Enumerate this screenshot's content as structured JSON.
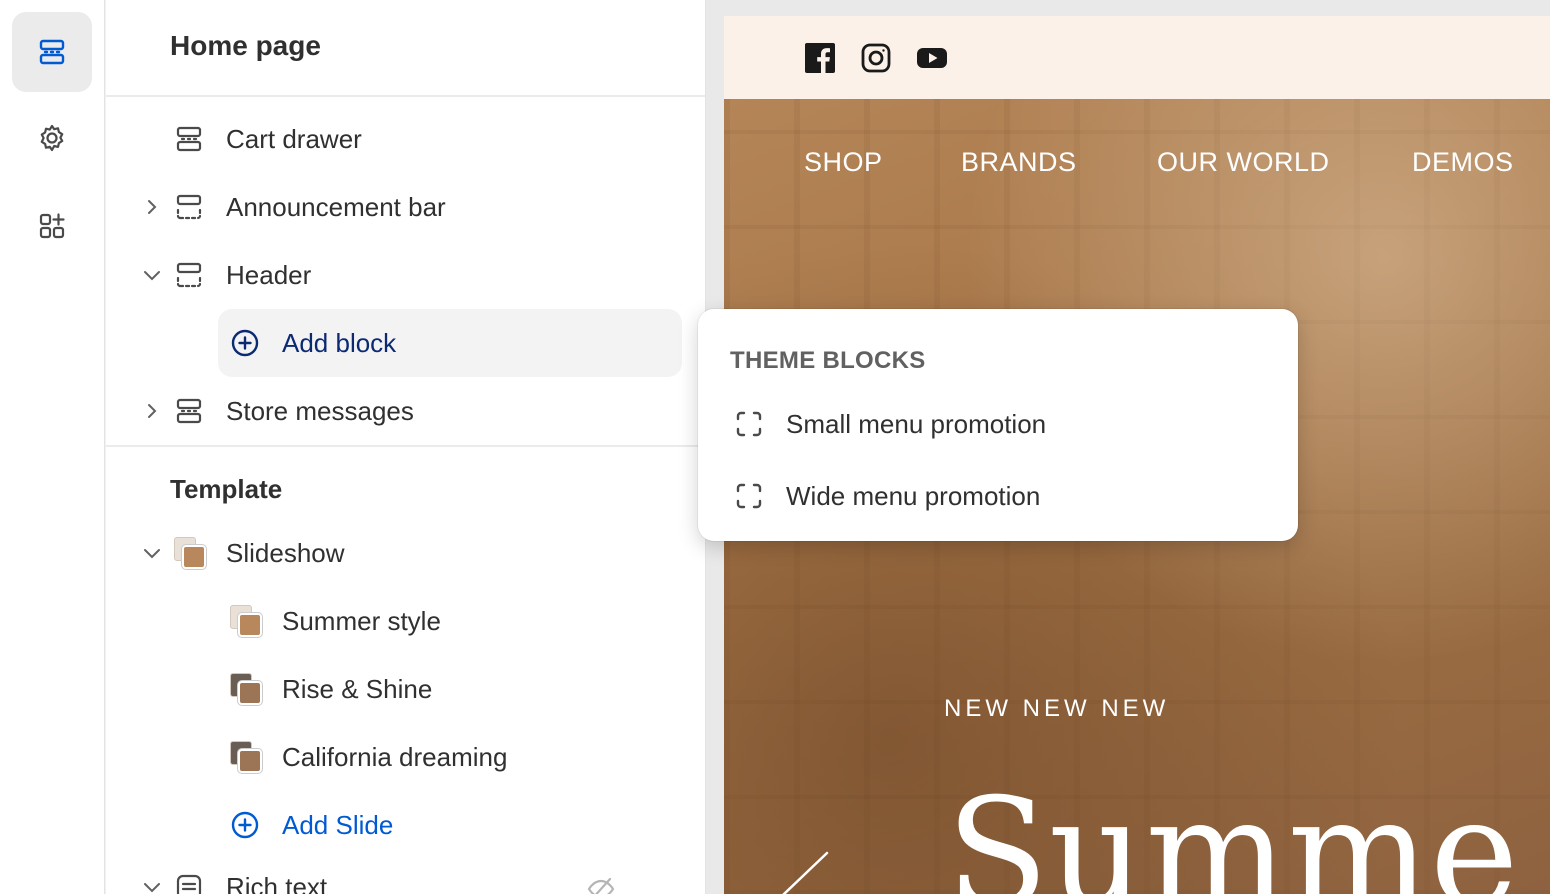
{
  "rail": {
    "items": [
      {
        "name": "sections",
        "icon": "sections-icon",
        "active": true
      },
      {
        "name": "settings",
        "icon": "gear-icon",
        "active": false
      },
      {
        "name": "apps",
        "icon": "apps-add-icon",
        "active": false
      }
    ]
  },
  "sidebar": {
    "title": "Home page",
    "header_group": {
      "cart_drawer": "Cart drawer",
      "announcement_bar": "Announcement bar",
      "header": "Header",
      "add_block": "Add block",
      "store_messages": "Store messages"
    },
    "template": {
      "title": "Template",
      "slideshow": "Slideshow",
      "slides": [
        "Summer style",
        "Rise & Shine",
        "California dreaming"
      ],
      "add_slide": "Add Slide",
      "rich_text": "Rich text"
    }
  },
  "popover": {
    "title": "THEME BLOCKS",
    "items": [
      "Small menu promotion",
      "Wide menu promotion"
    ]
  },
  "preview": {
    "social": [
      "facebook-icon",
      "instagram-icon",
      "youtube-icon"
    ],
    "nav": [
      "SHOP",
      "BRANDS",
      "OUR WORLD",
      "DEMOS"
    ],
    "hero_kicker": "NEW NEW NEW",
    "hero_title": "Summe"
  },
  "colors": {
    "accent_blue": "#005bd3",
    "topbar_bg": "#fbf1e8",
    "hero_tone": "#a77648"
  }
}
